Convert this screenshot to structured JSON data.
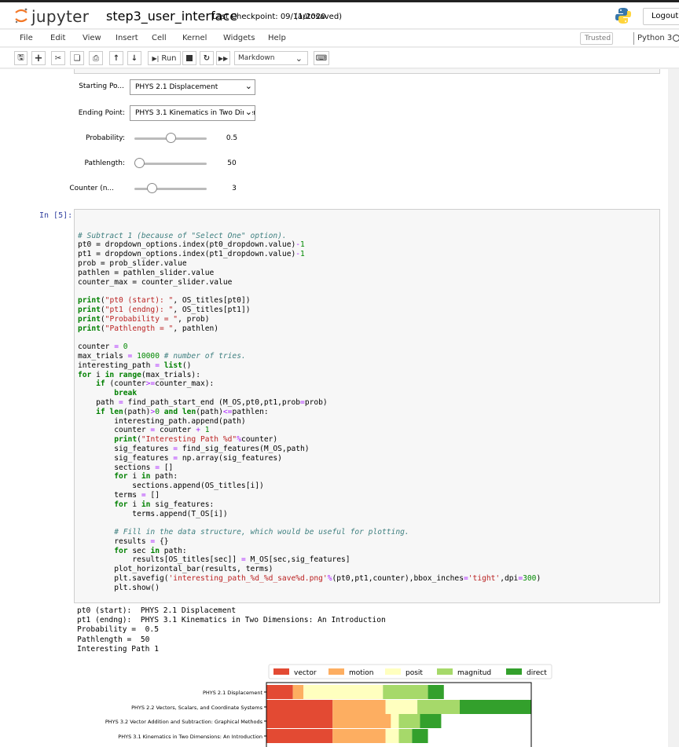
{
  "header": {
    "logo_text": "jupyter",
    "notebook_name": "step3_user_interface",
    "checkpoint": "Last Checkpoint: 09/11/2020",
    "autosaved": "(autosaved)",
    "logout_label": "Logout"
  },
  "menubar": {
    "items": [
      "File",
      "Edit",
      "View",
      "Insert",
      "Cell",
      "Kernel",
      "Widgets",
      "Help"
    ],
    "trusted": "Trusted",
    "kernel": "Python 3"
  },
  "toolbar": {
    "run_label": "Run",
    "cell_type": "Markdown"
  },
  "widgets": {
    "start_label": "Starting Po...",
    "start_value": "PHYS 2.1 Displacement",
    "end_label": "Ending Point:",
    "end_value": "PHYS 3.1 Kinematics in Two Dimensions: An Introduction",
    "prob_label": "Probability:",
    "prob_value": "0.5",
    "prob_level": 0.5,
    "pathlen_label": "Pathlength:",
    "pathlen_value": "50",
    "pathlen_level": 0.0,
    "counter_label": "Counter (n...",
    "counter_value": "3",
    "counter_level": 0.2
  },
  "cell": {
    "prompt": "In [5]:",
    "output_lines": [
      "pt0 (start):  PHYS 2.1 Displacement",
      "pt1 (endng):  PHYS 3.1 Kinematics in Two Dimensions: An Introduction",
      "Probability =  0.5",
      "Pathlength =  50",
      "Interesting Path 1"
    ]
  },
  "colors": {
    "vector": "#e34a33",
    "motion": "#fdae61",
    "posit": "#ffffbf",
    "magnitud": "#a6d96a",
    "direct": "#33a02c"
  },
  "chart_data": {
    "type": "bar",
    "orientation": "horizontal",
    "stacked": true,
    "categories": [
      "PHYS 2.1 Displacement",
      "PHYS 2.2 Vectors, Scalars, and Coordinate Systems",
      "PHYS 3.2 Vector Addition and Subtraction: Graphical Methods",
      "PHYS 3.1 Kinematics in Two Dimensions: An Introduction"
    ],
    "legend": [
      "vector",
      "motion",
      "posit",
      "magnitud",
      "direct"
    ],
    "legend_placement": "top-center",
    "series": [
      {
        "name": "vector",
        "values": [
          0.1,
          0.25,
          0.25,
          0.25
        ]
      },
      {
        "name": "motion",
        "values": [
          0.04,
          0.2,
          0.22,
          0.2
        ]
      },
      {
        "name": "posit",
        "values": [
          0.3,
          0.12,
          0.03,
          0.05
        ]
      },
      {
        "name": "magnitud",
        "values": [
          0.17,
          0.16,
          0.08,
          0.05
        ]
      },
      {
        "name": "direct",
        "values": [
          0.06,
          0.27,
          0.08,
          0.06
        ]
      }
    ],
    "xlim": [
      0,
      1.0
    ],
    "grid": false
  }
}
